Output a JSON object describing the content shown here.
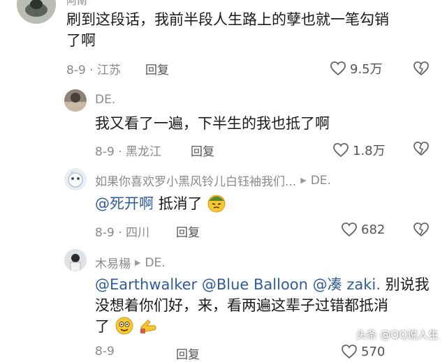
{
  "comments": [
    {
      "username": "阿南",
      "text_line1": "刷到这段话，我前半段人生路上的孽也就一笔勾销",
      "text_line2": "了啊",
      "meta": "8-9 · 江苏",
      "reply_label": "回复",
      "likes": "9.5万"
    },
    {
      "username": "DE.",
      "text": "我又看了一遍，下半生的我也抵了啊",
      "meta": "8-9 · 黑龙江",
      "reply_label": "回复",
      "likes": "1.8万"
    },
    {
      "username": "如果你喜欢罗小黑风铃儿白钰袖我们...",
      "reply_to": "DE.",
      "mention": "@死开啊",
      "text": "抵消了",
      "meta": "8-9 · 四川",
      "reply_label": "回复",
      "likes": "682"
    },
    {
      "username": "木易楊",
      "reply_to": "DE.",
      "mentions": [
        "@Earthwalker",
        "@Blue Balloon",
        "@凑 zaki."
      ],
      "text_line1_tail": "别说我",
      "text_line2": "没想着你们好，来，看两遍这辈子过错都抵消",
      "text_line3": "了",
      "meta": "8-9",
      "reply_label": "回复",
      "likes": "570"
    }
  ],
  "watermark": "头条 @QQ说人生",
  "colors": {
    "mention": "#2f5c9a",
    "meta": "#8a8a8a",
    "text": "#1a1a1a"
  }
}
